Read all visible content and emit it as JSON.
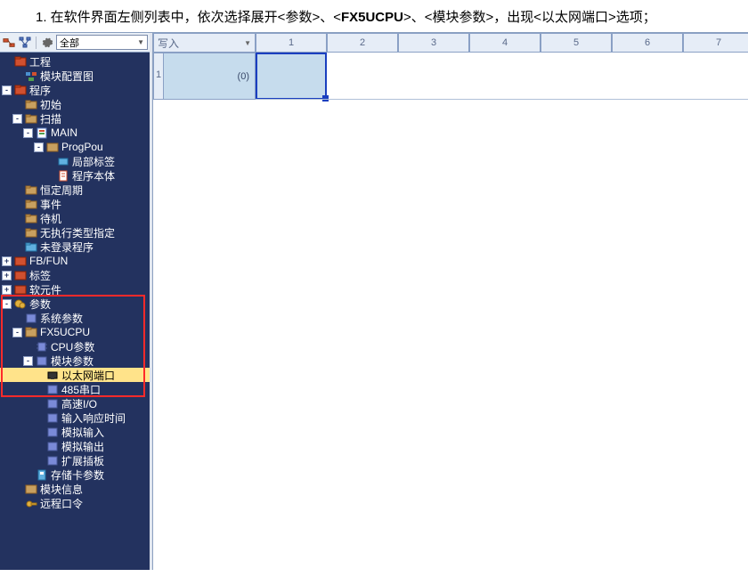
{
  "intro": {
    "prefix": "1. 在软件界面左侧列表中，依次选择展开<参数>、<",
    "bold": "FX5UCPU",
    "suffix": ">、<模块参数>，出现<以太网端口>选项；"
  },
  "toolbar": {
    "combo_label": "全部"
  },
  "tree": {
    "project": "工程",
    "module_config": "模块配置图",
    "program": "程序",
    "initial": "初始",
    "scan": "扫描",
    "main": "MAIN",
    "progpou": "ProgPou",
    "local_label": "局部标签",
    "prog_body": "程序本体",
    "fixed_cycle": "恒定周期",
    "event": "事件",
    "standby": "待机",
    "no_exec_type": "无执行类型指定",
    "unreg_prog": "未登录程序",
    "fbfun": "FB/FUN",
    "label": "标签",
    "device": "软元件",
    "params": "参数",
    "sys_params": "系统参数",
    "fx5ucpu": "FX5UCPU",
    "cpu_params": "CPU参数",
    "module_params": "模块参数",
    "eth_port": "以太网端口",
    "serial485": "485串口",
    "highspeed_io": "高速I/O",
    "input_resp": "输入响应时间",
    "analog_in": "模拟输入",
    "analog_out": "模拟输出",
    "ext_board": "扩展插板",
    "mem_card": "存储卡参数",
    "module_info": "模块信息",
    "remote_pwd": "远程口令"
  },
  "editor": {
    "corner_label": "写入",
    "row1": "1",
    "gutter_val": "(0)",
    "cols": {
      "c1": "1",
      "c2": "2",
      "c3": "3",
      "c4": "4",
      "c5": "5",
      "c6": "6",
      "c7": "7"
    }
  },
  "icons": {
    "folder_red": "#d04020",
    "folder_tan": "#c8a060",
    "leaf_green": "#50a050",
    "leaf_blue": "#4a8ad0",
    "leaf_unit": "#7a8ad8"
  }
}
